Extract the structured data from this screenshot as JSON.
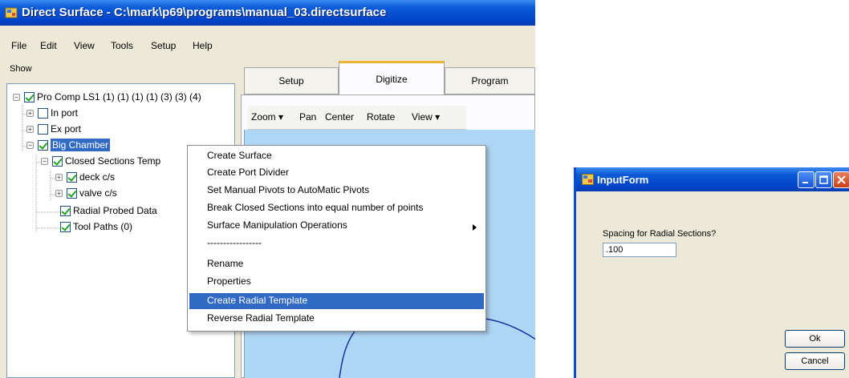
{
  "main_window": {
    "title": "Direct Surface - C:\\mark\\p69\\programs\\manual_03.directsurface",
    "menu": [
      "File",
      "Edit",
      "View",
      "Tools",
      "Setup",
      "Help"
    ],
    "show_label": "Show"
  },
  "tree": {
    "items": [
      {
        "label": "Pro Comp LS1 (1) (1) (1) (1) (3) (3) (4)",
        "checked": true
      },
      {
        "label": "In port",
        "checked": false
      },
      {
        "label": "Ex port",
        "checked": false
      },
      {
        "label": "Big Chamber",
        "checked": true,
        "selected": true
      },
      {
        "label": "Closed Sections Temp",
        "checked": true
      },
      {
        "label": "deck c/s",
        "checked": true
      },
      {
        "label": "valve c/s",
        "checked": true
      },
      {
        "label": "Radial Probed Data",
        "checked": true
      },
      {
        "label": "Tool Paths (0)",
        "checked": true
      }
    ]
  },
  "tabs": [
    {
      "label": "Setup",
      "active": false
    },
    {
      "label": "Digitize",
      "active": true
    },
    {
      "label": "Program",
      "active": false
    }
  ],
  "toolbar": {
    "zoom": "Zoom",
    "pan": "Pan",
    "center": "Center",
    "rotate": "Rotate",
    "view": "View"
  },
  "context_menu": {
    "items": [
      "Create Surface",
      "Create Port Divider",
      "Set Manual Pivots to AutoMatic Pivots",
      "Break Closed Sections into equal number of points",
      "Surface Manipulation Operations",
      "-----------------",
      "Rename",
      "Properties",
      "Create Radial Template",
      "Reverse Radial Template"
    ],
    "highlighted": "Create Radial Template"
  },
  "input_form": {
    "title": "InputForm",
    "prompt": "Spacing for Radial Sections?",
    "value": ".100",
    "ok_label": "Ok",
    "cancel_label": "Cancel"
  },
  "colors": {
    "title_bar": "#0043c8",
    "selection": "#316ac5",
    "canvas": "#aed6f5",
    "active_tab_accent": "#f0b436"
  }
}
